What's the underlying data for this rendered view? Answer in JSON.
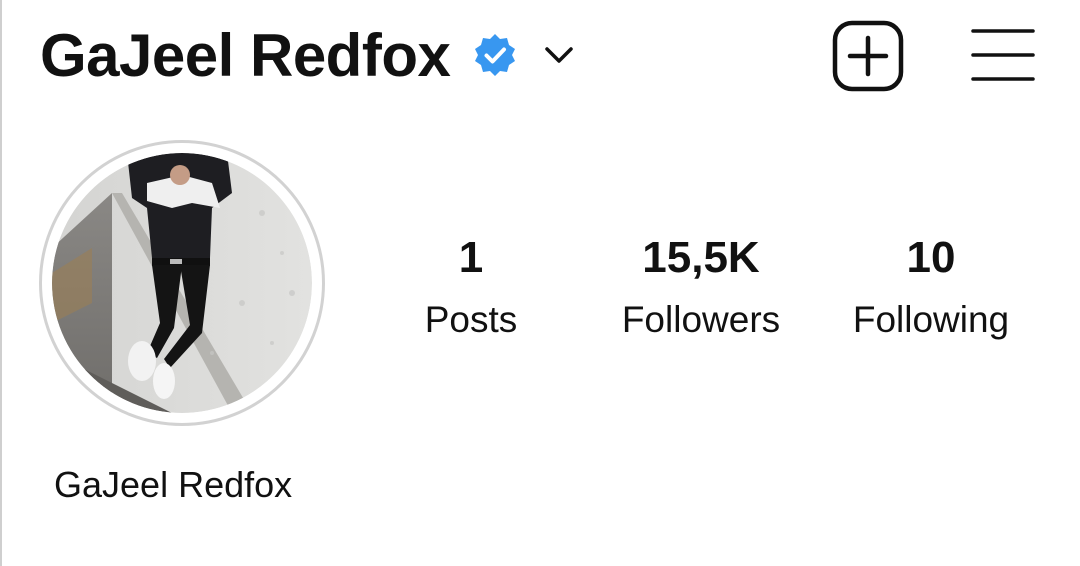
{
  "profile": {
    "username": "GaJeel Redfox",
    "display_name": "GaJeel Redfox",
    "verified": true
  },
  "icons": {
    "verified": "verified-badge-icon",
    "account_switch": "chevron-down-icon",
    "create": "plus-square-icon",
    "menu": "hamburger-menu-icon"
  },
  "stats": {
    "posts": {
      "value": "1",
      "label": "Posts"
    },
    "followers": {
      "value": "15,5K",
      "label": "Followers"
    },
    "following": {
      "value": "10",
      "label": "Following"
    }
  },
  "colors": {
    "verified_blue": "#3897f0",
    "text": "#111111",
    "avatar_ring": "#d2d2d2"
  }
}
